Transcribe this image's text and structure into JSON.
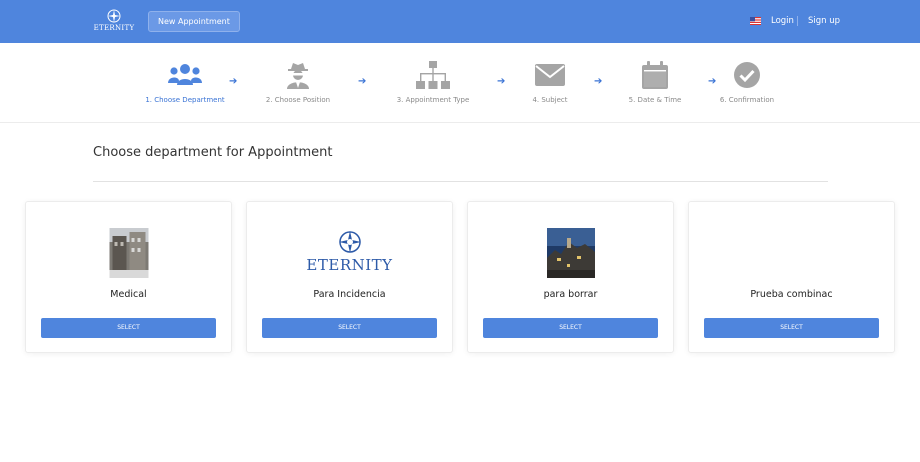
{
  "header": {
    "logo_text": "ETERNITY",
    "new_appointment": "New Appointment",
    "login": "Login",
    "signup": "Sign up"
  },
  "steps": [
    {
      "label": "1. Choose Department",
      "icon": "users-icon",
      "active": true
    },
    {
      "label": "2. Choose Position",
      "icon": "user-secret-icon",
      "active": false
    },
    {
      "label": "3. Appointment Type",
      "icon": "sitemap-icon",
      "active": false
    },
    {
      "label": "4. Subject",
      "icon": "envelope-icon",
      "active": false
    },
    {
      "label": "5. Date & Time",
      "icon": "calendar-icon",
      "active": false
    },
    {
      "label": "6. Confirmation",
      "icon": "check-circle-icon",
      "active": false
    }
  ],
  "section": {
    "title": "Choose department for Appointment"
  },
  "departments": [
    {
      "name": "Medical",
      "button": "SELECT",
      "image": "building-photo"
    },
    {
      "name": "Para Incidencia",
      "button": "SELECT",
      "image": "eternity-logo",
      "logo_text": "ETERNITY"
    },
    {
      "name": "para borrar",
      "button": "SELECT",
      "image": "town-photo"
    },
    {
      "name": "Prueba combinac",
      "button": "SELECT",
      "image": "none"
    }
  ],
  "colors": {
    "primary": "#4f85dd",
    "active_step": "#3b74d5",
    "inactive_icon": "#a5a5a5"
  }
}
